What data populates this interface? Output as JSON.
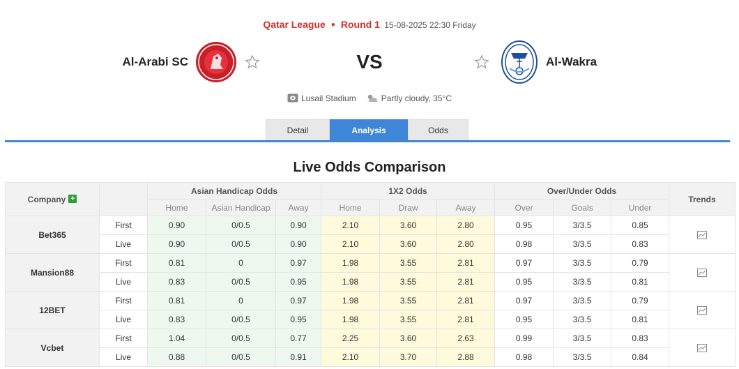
{
  "match": {
    "league": "Qatar League",
    "round": "Round 1",
    "datetime": "15-08-2025 22:30 Friday",
    "home_team": "Al-Arabi SC",
    "away_team": "Al-Wakra",
    "vs": "VS",
    "venue": "Lusail Stadium",
    "weather": "Partly cloudy, 35°C"
  },
  "tabs": [
    {
      "label": "Detail"
    },
    {
      "label": "Analysis"
    },
    {
      "label": "Odds"
    }
  ],
  "section_title": "Live Odds Comparison",
  "table": {
    "company_header": "Company",
    "groups": [
      "Asian Handicap Odds",
      "1X2 Odds",
      "Over/Under Odds"
    ],
    "trends_header": "Trends",
    "sub_headers": [
      "Home",
      "Asian Handicap",
      "Away",
      "Home",
      "Draw",
      "Away",
      "Over",
      "Goals",
      "Under"
    ],
    "rows": [
      {
        "company": "Bet365",
        "first": [
          "First",
          "0.90",
          "0/0.5",
          "0.90",
          "2.10",
          "3.60",
          "2.80",
          "0.95",
          "3/3.5",
          "0.85"
        ],
        "live": [
          "Live",
          "0.90",
          "0/0.5",
          "0.90",
          "2.10",
          "3.60",
          "2.80",
          "0.98",
          "3/3.5",
          "0.83"
        ]
      },
      {
        "company": "Mansion88",
        "first": [
          "First",
          "0.81",
          "0",
          "0.97",
          "1.98",
          "3.55",
          "2.81",
          "0.97",
          "3/3.5",
          "0.79"
        ],
        "live": [
          "Live",
          "0.83",
          "0/0.5",
          "0.95",
          "1.98",
          "3.55",
          "2.81",
          "0.95",
          "3/3.5",
          "0.81"
        ]
      },
      {
        "company": "12BET",
        "first": [
          "First",
          "0.81",
          "0",
          "0.97",
          "1.98",
          "3.55",
          "2.81",
          "0.97",
          "3/3.5",
          "0.79"
        ],
        "live": [
          "Live",
          "0.83",
          "0/0.5",
          "0.95",
          "1.98",
          "3.55",
          "2.81",
          "0.95",
          "3/3.5",
          "0.81"
        ]
      },
      {
        "company": "Vcbet",
        "first": [
          "First",
          "1.04",
          "0/0.5",
          "0.77",
          "2.25",
          "3.60",
          "2.63",
          "0.99",
          "3/3.5",
          "0.83"
        ],
        "live": [
          "Live",
          "0.88",
          "0/0.5",
          "0.91",
          "2.10",
          "3.70",
          "2.88",
          "0.98",
          "3/3.5",
          "0.84"
        ]
      }
    ]
  },
  "colors": {
    "accent_blue": "#3f86d8",
    "league_red": "#d0312d",
    "ah_bg": "#eef8ee",
    "x12_bg": "#fdfbdc",
    "plus_green": "#2e9e3a"
  }
}
